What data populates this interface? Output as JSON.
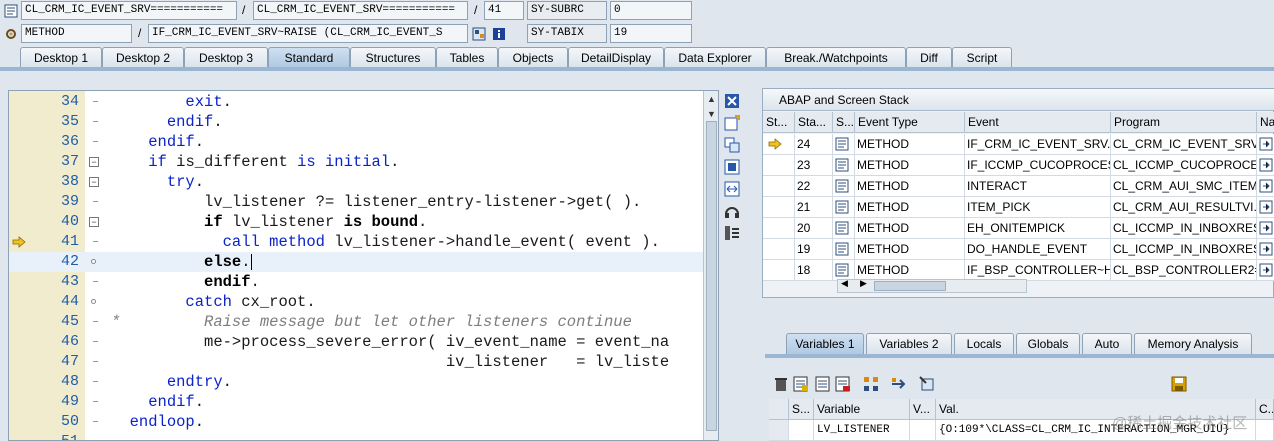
{
  "info": {
    "row1": {
      "class_field": "CL_CRM_IC_EVENT_SRV===========",
      "slash1": "/",
      "class_field2": "CL_CRM_IC_EVENT_SRV===========",
      "slash2": "/",
      "line": "41",
      "sysvar_name": "SY-SUBRC",
      "sysvar_value": "0"
    },
    "row2": {
      "type": "METHOD",
      "slash": "/",
      "method": "IF_CRM_IC_EVENT_SRV~RAISE (CL_CRM_IC_EVENT_S",
      "sysvar_name": "SY-TABIX",
      "sysvar_value": "19"
    }
  },
  "tabs": [
    {
      "label": "Desktop 1"
    },
    {
      "label": "Desktop 2"
    },
    {
      "label": "Desktop 3"
    },
    {
      "label": "Standard",
      "active": true
    },
    {
      "label": "Structures"
    },
    {
      "label": "Tables"
    },
    {
      "label": "Objects"
    },
    {
      "label": "DetailDisplay"
    },
    {
      "label": "Data Explorer"
    },
    {
      "label": "Break./Watchpoints"
    },
    {
      "label": "Diff"
    },
    {
      "label": "Script"
    }
  ],
  "editor": {
    "current_line": "41",
    "lines": [
      {
        "num": "34",
        "code": "        exit."
      },
      {
        "num": "35",
        "code": "      endif."
      },
      {
        "num": "36",
        "code": "    endif."
      },
      {
        "num": "37",
        "code": "    if is_different is initial."
      },
      {
        "num": "38",
        "code": "      try."
      },
      {
        "num": "39",
        "code": "          lv_listener ?= listener_entry-listener->get( )."
      },
      {
        "num": "40",
        "code": "          if lv_listener is bound."
      },
      {
        "num": "41",
        "code": "            call method lv_listener->handle_event( event )."
      },
      {
        "num": "42",
        "code": "          else."
      },
      {
        "num": "43",
        "code": "          endif."
      },
      {
        "num": "44",
        "code": "        catch cx_root."
      },
      {
        "num": "45",
        "code": "*         Raise message but let other listeners continue"
      },
      {
        "num": "46",
        "code": "          me->process_severe_error( iv_event_name = event_na"
      },
      {
        "num": "47",
        "code": "                                    iv_listener   = lv_liste"
      },
      {
        "num": "48",
        "code": "      endtry."
      },
      {
        "num": "49",
        "code": "    endif."
      },
      {
        "num": "50",
        "code": "  endloop."
      },
      {
        "num": "51",
        "code": ""
      }
    ]
  },
  "stack": {
    "title": "ABAP and Screen Stack",
    "columns": [
      "St...",
      "Sta...",
      "S...",
      "Event Type",
      "Event",
      "Program",
      "Na..."
    ],
    "rows": [
      {
        "level": "24",
        "type": "METHOD",
        "event": "IF_CRM_IC_EVENT_SRV...",
        "program": "CL_CRM_IC_EVENT_SRV...",
        "current": true
      },
      {
        "level": "23",
        "type": "METHOD",
        "event": "IF_ICCMP_CUCOPROCES...",
        "program": "CL_ICCMP_CUCOPROCES..."
      },
      {
        "level": "22",
        "type": "METHOD",
        "event": "INTERACT",
        "program": "CL_CRM_AUI_SMC_ITEM..."
      },
      {
        "level": "21",
        "type": "METHOD",
        "event": "ITEM_PICK",
        "program": "CL_CRM_AUI_RESULTVI..."
      },
      {
        "level": "20",
        "type": "METHOD",
        "event": "EH_ONITEMPICK",
        "program": "CL_ICCMP_IN_INBOXRES..."
      },
      {
        "level": "19",
        "type": "METHOD",
        "event": "DO_HANDLE_EVENT",
        "program": "CL_ICCMP_IN_INBOXRES..."
      },
      {
        "level": "18",
        "type": "METHOD",
        "event": "IF_BSP_CONTROLLER~H...",
        "program": "CL_BSP_CONTROLLER2=..."
      }
    ]
  },
  "var_tabs": [
    {
      "label": "Variables 1",
      "active": true
    },
    {
      "label": "Variables 2"
    },
    {
      "label": "Locals"
    },
    {
      "label": "Globals"
    },
    {
      "label": "Auto"
    },
    {
      "label": "Memory Analysis"
    }
  ],
  "variables": {
    "columns": [
      "S...",
      "Variable",
      "V...",
      "Val.",
      "C..."
    ],
    "rows": [
      {
        "name": "LV_LISTENER",
        "value": "{O:109*\\CLASS=CL_CRM_IC_INTERACTION_MGR_UIU}"
      }
    ]
  },
  "watermark": "@稀土掘金技术社区",
  "colors": {
    "keyword": "#0b23c8",
    "comment": "#7e7e7e",
    "gutter": "#f2eccf",
    "tab_active": "#aec8e2",
    "current_line": "#e8f0fa"
  }
}
